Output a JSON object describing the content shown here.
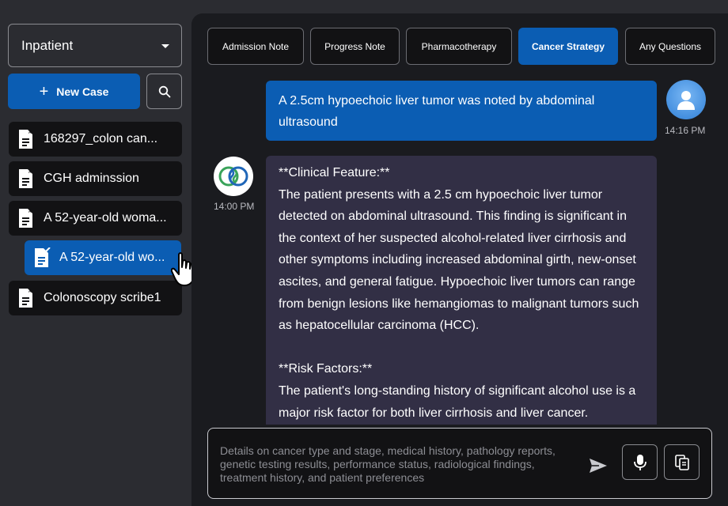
{
  "sidebar": {
    "mode_select": {
      "value": "Inpatient"
    },
    "new_case_label": "New Case",
    "cases": [
      {
        "label": "168297_colon can..."
      },
      {
        "label": "CGH adminssion"
      },
      {
        "label": "A 52-year-old woma..."
      },
      {
        "label": "A 52-year-old wo..."
      },
      {
        "label": "Colonoscopy scribe1"
      }
    ]
  },
  "tabs": [
    {
      "label": "Admission Note"
    },
    {
      "label": "Progress Note"
    },
    {
      "label": "Pharmacotherapy"
    },
    {
      "label": "Cancer Strategy"
    },
    {
      "label": "Any Questions"
    }
  ],
  "chat": {
    "user_message": {
      "text": "A 2.5cm hypoechoic liver tumor was noted by abdominal ultrasound",
      "time": "14:16 PM"
    },
    "bot_message": {
      "time": "14:00 PM",
      "heading1": "**Clinical Feature:**",
      "paragraph1": "The patient presents with a 2.5 cm hypoechoic liver tumor detected on abdominal ultrasound. This finding is significant in the context of her suspected alcohol-related liver cirrhosis and other symptoms including increased abdominal girth, new-onset ascites, and general fatigue. Hypoechoic liver tumors can range from benign lesions like hemangiomas to malignant tumors such as hepatocellular carcinoma (HCC).",
      "heading2": "**Risk Factors:**",
      "paragraph2": "The patient's long-standing history of significant alcohol use is a major risk factor for both liver cirrhosis and liver cancer."
    }
  },
  "composer": {
    "placeholder": "Details on cancer type and stage, medical history, pathology reports, genetic testing results, performance status, radiological findings, treatment history, and patient preferences"
  },
  "colors": {
    "accent": "#0b5db3",
    "panel": "#1a1b1f",
    "bot_bubble": "#322f45",
    "sidebar": "#2b2c31"
  }
}
